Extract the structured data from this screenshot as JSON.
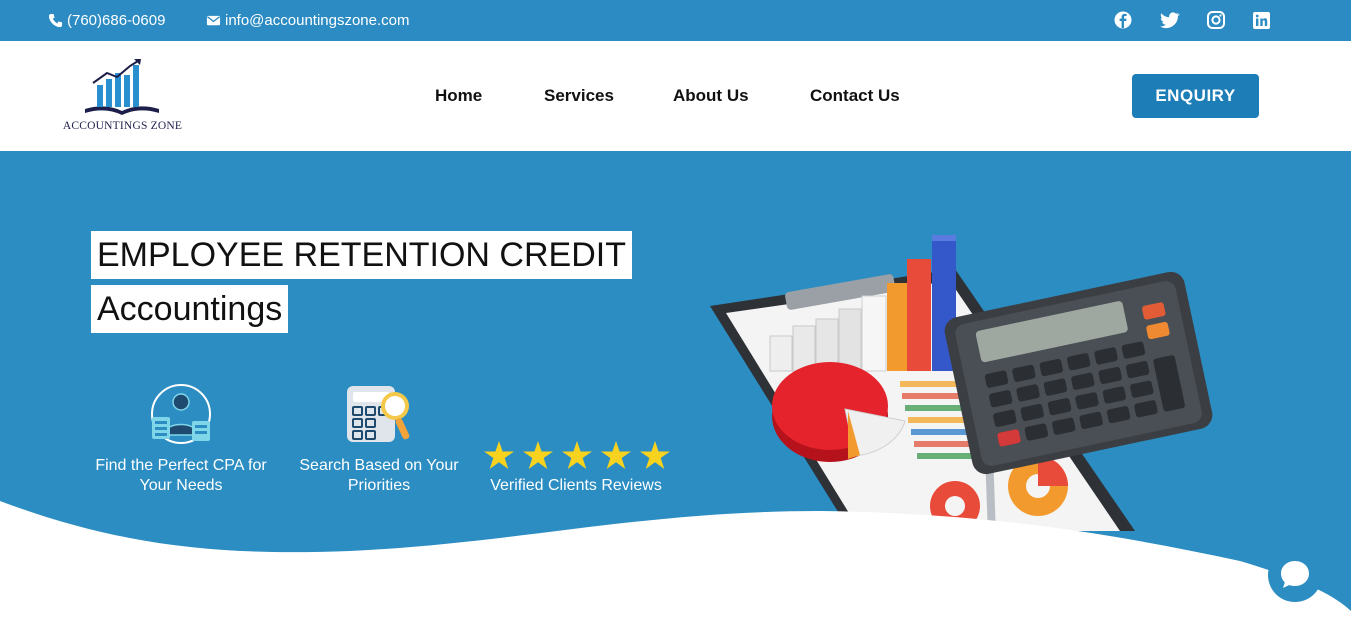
{
  "topbar": {
    "phone": "(760)686-0609",
    "email": "info@accountingszone.com",
    "social": [
      "facebook-icon",
      "twitter-icon",
      "instagram-icon",
      "linkedin-icon"
    ]
  },
  "header": {
    "logo_text": "ACCOUNTINGS ZONE",
    "nav": [
      "Home",
      "Services",
      "About Us",
      "Contact Us"
    ],
    "enquiry": "ENQUIRY"
  },
  "hero": {
    "title_line1": "EMPLOYEE RETENTION CREDIT",
    "title_line2": "Accountings",
    "features": [
      {
        "line1": "Find the Perfect CPA for",
        "line2": "Your Needs"
      },
      {
        "line1": "Search Based on Your",
        "line2": "Priorities"
      },
      {
        "line1": "Verified Clients Reviews",
        "line2": ""
      }
    ],
    "rating_stars": 5
  },
  "colors": {
    "brand_blue": "#2b8dc2",
    "button_blue": "#1d7db7",
    "star": "#f7d21e"
  }
}
